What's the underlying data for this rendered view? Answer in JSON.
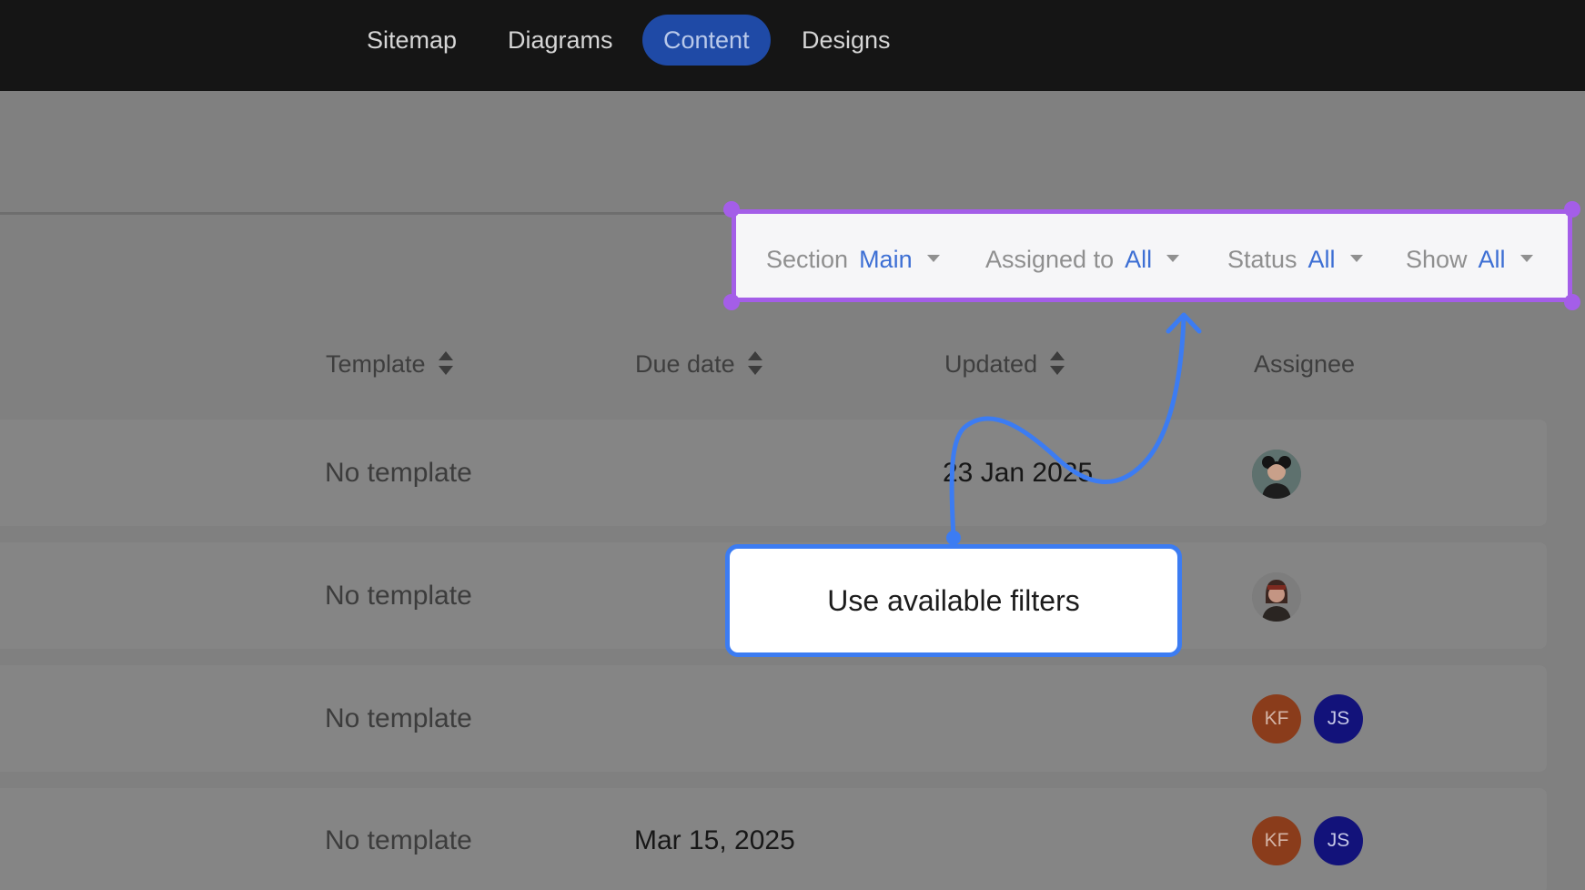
{
  "nav": {
    "tabs": [
      {
        "label": "Sitemap"
      },
      {
        "label": "Diagrams"
      },
      {
        "label": "Content",
        "active": true
      },
      {
        "label": "Designs"
      }
    ]
  },
  "filters": {
    "section": {
      "label": "Section",
      "value": "Main"
    },
    "assigned_to": {
      "label": "Assigned to",
      "value": "All"
    },
    "status": {
      "label": "Status",
      "value": "All"
    },
    "show": {
      "label": "Show",
      "value": "All"
    }
  },
  "table": {
    "columns": {
      "template": "Template",
      "due_date": "Due date",
      "updated": "Updated",
      "assignee": "Assignee"
    },
    "rows": [
      {
        "template": "No template",
        "due_date": "",
        "updated": "23 Jan 2025",
        "assignees": [
          "avatar-photo"
        ]
      },
      {
        "template": "No template",
        "due_date": "",
        "updated": "",
        "assignees": [
          "avatar-photo"
        ]
      },
      {
        "template": "No template",
        "due_date": "",
        "updated": "",
        "assignees": [
          "KF",
          "JS"
        ]
      },
      {
        "template": "No template",
        "due_date": "Mar 15, 2025",
        "updated": "",
        "assignees": [
          "KF",
          "JS"
        ]
      }
    ]
  },
  "tooltip": {
    "text": "Use available filters"
  },
  "colors": {
    "highlight": "#a45ee8",
    "accent": "#3c7cf2",
    "active_tab": "#1f4aa6",
    "kf_avatar": "#8a3c1b",
    "js_avatar": "#12127a"
  }
}
